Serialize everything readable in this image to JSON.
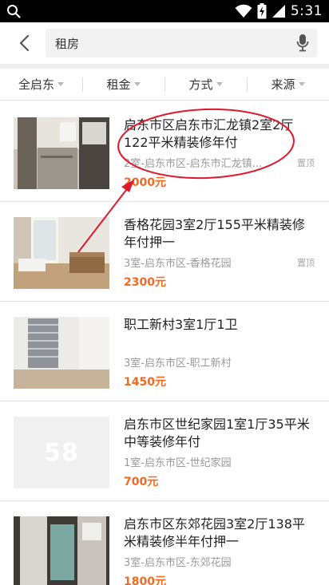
{
  "status_bar": {
    "time": "5:31",
    "icons": [
      "search-icon",
      "wifi-icon",
      "battery-charging-icon",
      "cell-signal-icon"
    ]
  },
  "header": {
    "back_icon": "back-arrow-icon",
    "search_query": "租房",
    "mic_icon": "microphone-icon"
  },
  "filters": [
    {
      "label": "全启东"
    },
    {
      "label": "租金"
    },
    {
      "label": "方式"
    },
    {
      "label": "来源"
    }
  ],
  "listings": [
    {
      "title": "启东市区启东市汇龙镇2室2厅122平米精装修年付",
      "meta": "2室-启东市区-启东市汇龙镇...",
      "badge": "置顶",
      "price": "2000元"
    },
    {
      "title": "香格花园3室2厅155平米精装修年付押一",
      "meta": "3室-启东市区-香格花园",
      "badge": "置顶",
      "price": "2300元"
    },
    {
      "title": "职工新村3室1厅1卫",
      "meta": "3室-启东市区-职工新村",
      "badge": "",
      "price": "1450元"
    },
    {
      "title": "启东市区世纪家园1室1厅35平米中等装修年付",
      "meta": "1室-启东市区-世纪家园",
      "badge": "",
      "price": "700元",
      "placeholder_logo": "58"
    },
    {
      "title": "启东市区东郊花园3室2厅138平米精装修半年付押一",
      "meta": "3室-启东市区-东郊花园",
      "badge": "",
      "price": "1800元"
    }
  ],
  "colors": {
    "price": "#f26a21",
    "annotation": "#e0182d",
    "meta": "#999999"
  }
}
